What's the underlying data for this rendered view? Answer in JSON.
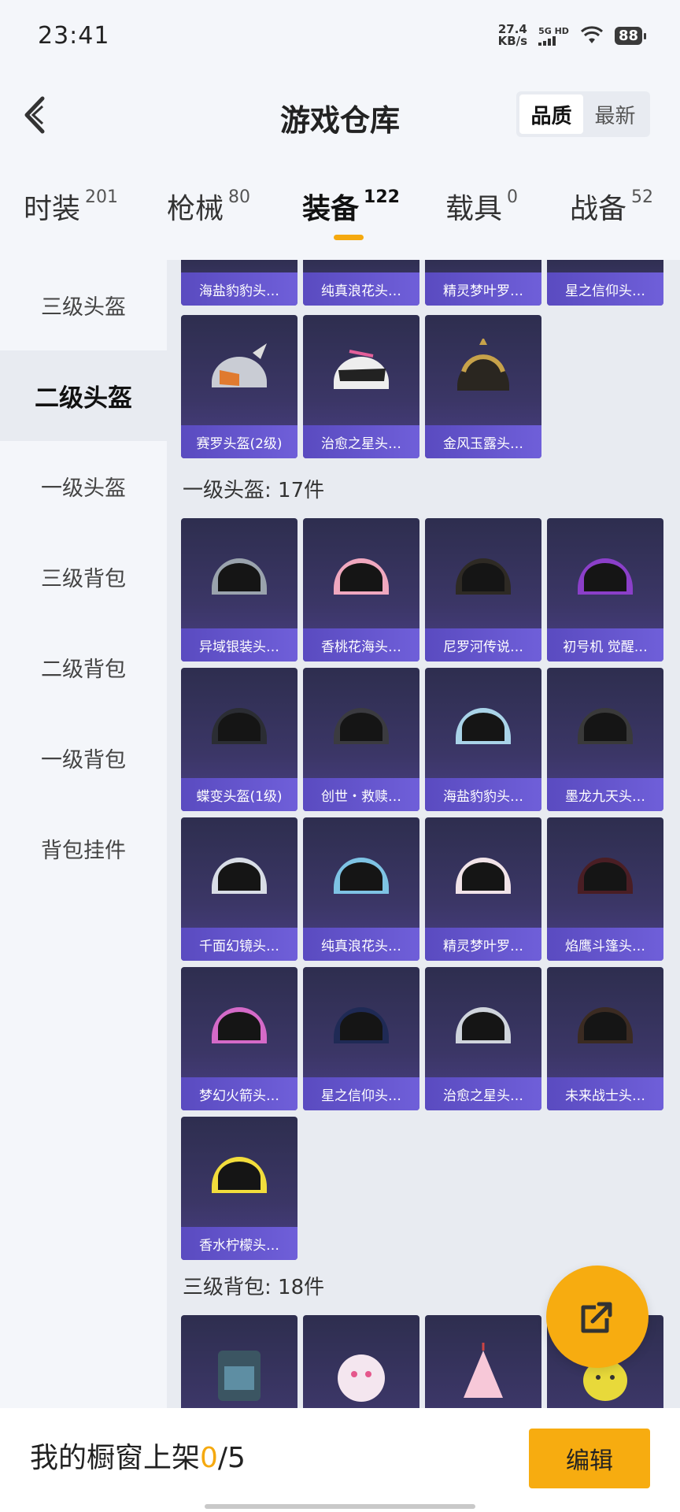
{
  "status": {
    "time": "23:41",
    "speed": "27.4",
    "speed_unit": "KB/s",
    "network": "5G HD",
    "battery": "88"
  },
  "header": {
    "title": "游戏仓库",
    "sort_options": [
      "品质",
      "最新"
    ],
    "active_sort": "品质"
  },
  "tabs": [
    {
      "label": "时装",
      "count": "201"
    },
    {
      "label": "枪械",
      "count": "80"
    },
    {
      "label": "装备",
      "count": "122",
      "active": true
    },
    {
      "label": "载具",
      "count": "0"
    },
    {
      "label": "战备",
      "count": "52"
    }
  ],
  "sidebar": [
    "三级头盔",
    "二级头盔",
    "一级头盔",
    "三级背包",
    "二级背包",
    "一级背包",
    "背包挂件"
  ],
  "sidebar_active": "二级头盔",
  "sections": {
    "prev_partial": [
      "海盐豹豹头…",
      "纯真浪花头…",
      "精灵梦叶罗…",
      "星之信仰头…"
    ],
    "level2_tail": [
      "赛罗头盔(2级)",
      "治愈之星头…",
      "金风玉露头…"
    ],
    "level1": {
      "title": "一级头盔: 17件",
      "items": [
        "异域银装头…",
        "香桃花海头…",
        "尼罗河传说…",
        "初号机 觉醒…",
        "蝶变头盔(1级)",
        "创世・救赎…",
        "海盐豹豹头…",
        "墨龙九天头…",
        "千面幻镜头…",
        "纯真浪花头…",
        "精灵梦叶罗…",
        "焰鹰斗篷头…",
        "梦幻火箭头…",
        "星之信仰头…",
        "治愈之星头…",
        "未来战士头…",
        "香水柠檬头…"
      ]
    },
    "level3_backpack": {
      "title": "三级背包: 18件"
    }
  },
  "bottom": {
    "showcase_label": "我的橱窗上架",
    "showcase_count": "0",
    "showcase_total": "/5",
    "edit_label": "编辑"
  },
  "colors": {
    "accent": "#f7ac10",
    "card_label": "#6354cc"
  },
  "icons": [
    "back-arrow-icon",
    "share-external-icon"
  ]
}
